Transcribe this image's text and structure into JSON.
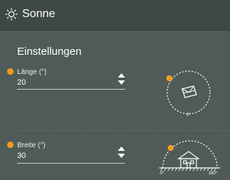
{
  "header": {
    "title": "Sonne",
    "icon": "sun-icon"
  },
  "section": {
    "title": "Einstellungen"
  },
  "fields": [
    {
      "label": "Länge (°)",
      "value": "20",
      "accent": "#f39c1a"
    },
    {
      "label": "Breite (°)",
      "value": "30",
      "accent": "#f39c1a"
    }
  ],
  "diagrams": {
    "longitude": {
      "zero_label": "0°"
    },
    "latitude": {
      "left_label": "0°",
      "right_label": "180°"
    }
  },
  "colors": {
    "background": "#4f5b59",
    "header": "#3e4846",
    "accent": "#f39c1a"
  }
}
